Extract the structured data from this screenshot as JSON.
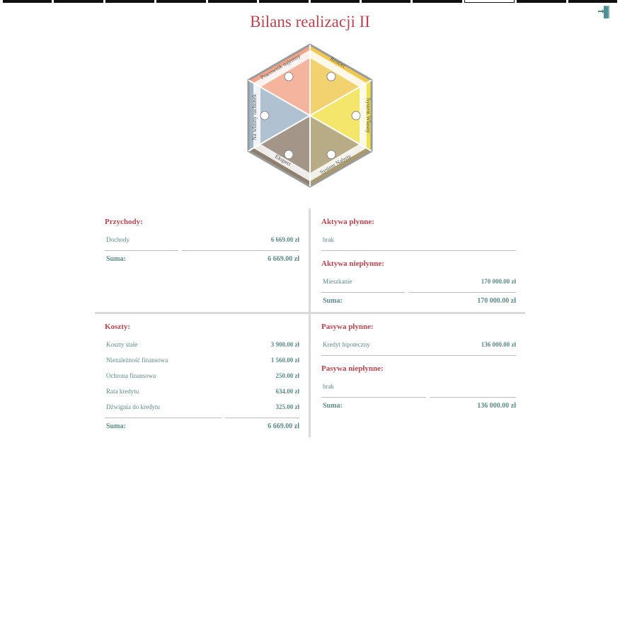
{
  "nav": {
    "tab_count": 12,
    "active_index": 9
  },
  "exit": {
    "icon": "exit-door-icon"
  },
  "title": "Bilans realizacji II",
  "hexagon": {
    "segments": [
      "Pracownik najemny",
      "Rentier",
      "System Własny",
      "System Nabyty",
      "Ekspert",
      "Na własny rachunek"
    ],
    "colors": [
      "#f2a489",
      "#f0c84f",
      "#f1e14a",
      "#a89a6c",
      "#8f7f6f",
      "#9fb5c7"
    ]
  },
  "income": {
    "title": "Przychody:",
    "rows": [
      {
        "label": "Dochody",
        "value": "6 669.00 zł"
      }
    ],
    "sum_label": "Suma:",
    "sum_value": "6 669.00 zł"
  },
  "liquid_assets": {
    "title": "Aktywa płynne:",
    "rows": [
      {
        "label": "brak",
        "value": ""
      }
    ]
  },
  "illiquid_assets": {
    "title": "Aktywa niepłynne:",
    "rows": [
      {
        "label": "Mieszkanie",
        "value": "170 000.00 zł"
      }
    ],
    "sum_label": "Suma:",
    "sum_value": "170 000.00 zł"
  },
  "costs": {
    "title": "Koszty:",
    "rows": [
      {
        "label": "Koszty stałe",
        "value": "3 900.00 zł"
      },
      {
        "label": "Niezależność finansowa",
        "value": "1 560.00 zł"
      },
      {
        "label": "Ochrona finansowa",
        "value": "250.00 zł"
      },
      {
        "label": "Rata kredytu",
        "value": "634.00 zł"
      },
      {
        "label": "Dźwignia do kredytu",
        "value": "325.00 zł"
      }
    ],
    "sum_label": "Suma:",
    "sum_value": "6 669.00 zł"
  },
  "liquid_liabilities": {
    "title": "Pasywa płynne:",
    "rows": [
      {
        "label": "Kredyt hipoteczny",
        "value": "136 000.00 zł"
      }
    ]
  },
  "illiquid_liabilities": {
    "title": "Pasywa niepłynne:",
    "rows": [
      {
        "label": "brak",
        "value": ""
      }
    ],
    "sum_label": "Suma:",
    "sum_value": "136 000.00 zł"
  }
}
